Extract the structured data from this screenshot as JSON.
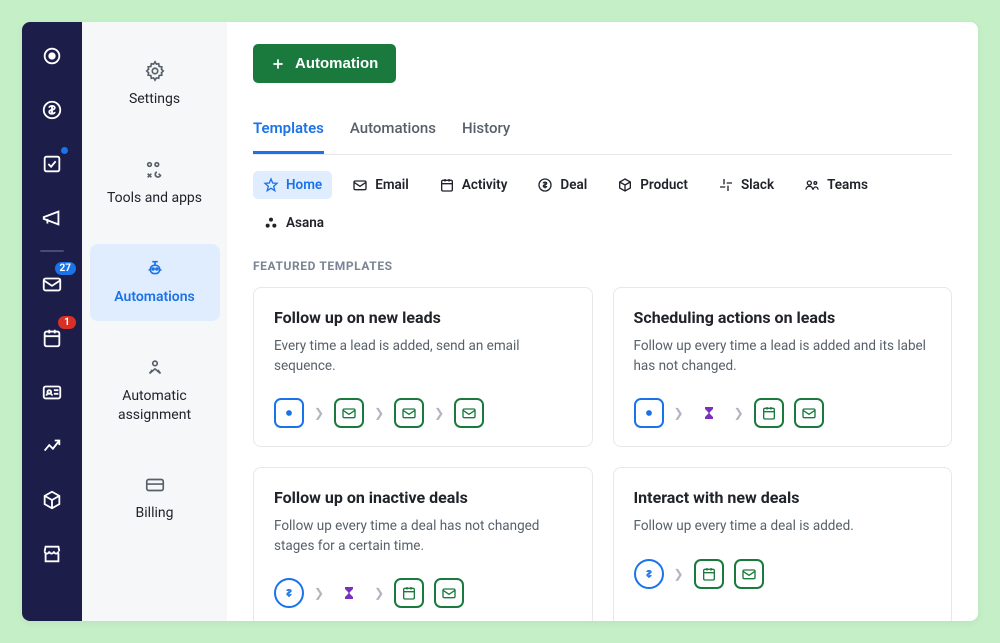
{
  "header": {
    "primary_button_label": "Automation"
  },
  "tabs": [
    {
      "label": "Templates",
      "active": true
    },
    {
      "label": "Automations",
      "active": false
    },
    {
      "label": "History",
      "active": false
    }
  ],
  "filters": [
    {
      "label": "Home",
      "icon": "star",
      "active": true
    },
    {
      "label": "Email",
      "icon": "mail",
      "active": false
    },
    {
      "label": "Activity",
      "icon": "calendar",
      "active": false
    },
    {
      "label": "Deal",
      "icon": "dollar",
      "active": false
    },
    {
      "label": "Product",
      "icon": "box",
      "active": false
    },
    {
      "label": "Slack",
      "icon": "slack",
      "active": false
    },
    {
      "label": "Teams",
      "icon": "teams",
      "active": false
    },
    {
      "label": "Asana",
      "icon": "asana",
      "active": false
    }
  ],
  "section_label": "FEATURED TEMPLATES",
  "cards": [
    {
      "title": "Follow up on new leads",
      "desc": "Every time a lead is added, send an email sequence.",
      "flow": [
        "target",
        "mail",
        "mail",
        "mail"
      ]
    },
    {
      "title": "Scheduling actions on leads",
      "desc": "Follow up every time a lead is added and its label has not changed.",
      "flow": [
        "target",
        "wait",
        "cal+mail"
      ]
    },
    {
      "title": "Follow up on inactive deals",
      "desc": "Follow up every time a deal has not changed stages for a certain time.",
      "flow": [
        "dollar",
        "wait",
        "cal+mail"
      ]
    },
    {
      "title": "Interact with new deals",
      "desc": "Follow up every time a deal is added.",
      "flow": [
        "dollar",
        "cal+mail"
      ]
    }
  ],
  "side_items": [
    {
      "label": "Settings",
      "icon": "gear"
    },
    {
      "label": "Tools and apps",
      "icon": "tools"
    },
    {
      "label": "Automations",
      "icon": "robot",
      "active": true
    },
    {
      "label": "Automatic assignment",
      "icon": "assign"
    },
    {
      "label": "Billing",
      "icon": "card"
    }
  ],
  "nav_badges": {
    "deals_dot": true,
    "mail_count": "27",
    "calendar_count": "1"
  }
}
